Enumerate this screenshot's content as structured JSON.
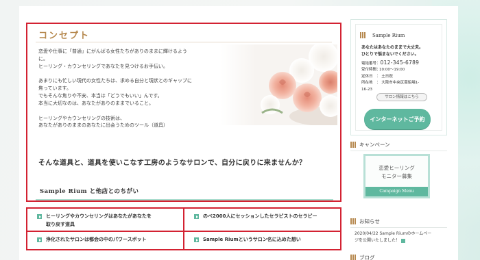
{
  "concept": {
    "title": "コンセプト",
    "paragraphs": [
      [
        "恋愛や仕事に「普通」にがんばる女性たちがありのままに輝けるよう",
        "に。",
        "ヒーリング・カウンセリングであなたを見つけるお手伝い。"
      ],
      [
        "あまりにも忙しい現代の女性たちは、求める自分と現状とのギャップに",
        "焦っています。",
        "でもそんな焦りや不安、本当は「どうでもいい」んです。",
        "本当に大切なのは、あなたがありのままでいること。"
      ],
      [
        "ヒーリングやカウンセリングの技術は、",
        "あなたがありのままのあなたに出会うためのツール（道具）"
      ]
    ],
    "lead": "そんな道具と、道具を使いこなす工房のようなサロンで、自分に戻りに来ませんか？",
    "diff_heading": "Sample Rium と他店とのちがい"
  },
  "links": [
    {
      "label_line1": "ヒーリングやカウンセリングはあなたがあなたを",
      "label_line2": "取り戻す道具"
    },
    {
      "label_line1": "のべ2000人にセッションしたセラピストのセラピー",
      "label_line2": ""
    },
    {
      "label_line1": "浄化されたサロンは都会の中のパワースポット",
      "label_line2": ""
    },
    {
      "label_line1": "Sample Riumというサロン名に込めた想い",
      "label_line2": ""
    }
  ],
  "sidebar": {
    "salon_name": "Sample Rium",
    "catch_line1": "あなたはあなたのままで大丈夫。",
    "catch_line2": "ひとりで悩まないでください。",
    "phone_label": "電話番号：",
    "phone_number": "012-345-6789",
    "info": [
      {
        "k": "受付時間：",
        "v": "10:00～19:00"
      },
      {
        "k": "定休日",
        "v": "：  土日祝"
      },
      {
        "k": "所在地",
        "v": "：  大阪市中央区南船場1-"
      },
      {
        "k": "16-23",
        "v": ""
      }
    ],
    "salon_info_button": "サロン情報はこちら",
    "reserve_button": "インターネットご予約",
    "campaign_heading": "キャンペーン",
    "campaign_line1": "恋愛ヒーリング",
    "campaign_line2": "モニター募集",
    "campaign_footer": "Campaign Menu",
    "news_heading": "お知らせ",
    "news_item_line1": "2020/04/22 Sample Riumのホームペー",
    "news_item_line2": "ジを公開いたしました！",
    "blog_heading": "ブログ"
  },
  "colors": {
    "accent_gold": "#b6894f",
    "accent_green": "#5fb89f",
    "highlight_red": "#d32232"
  }
}
